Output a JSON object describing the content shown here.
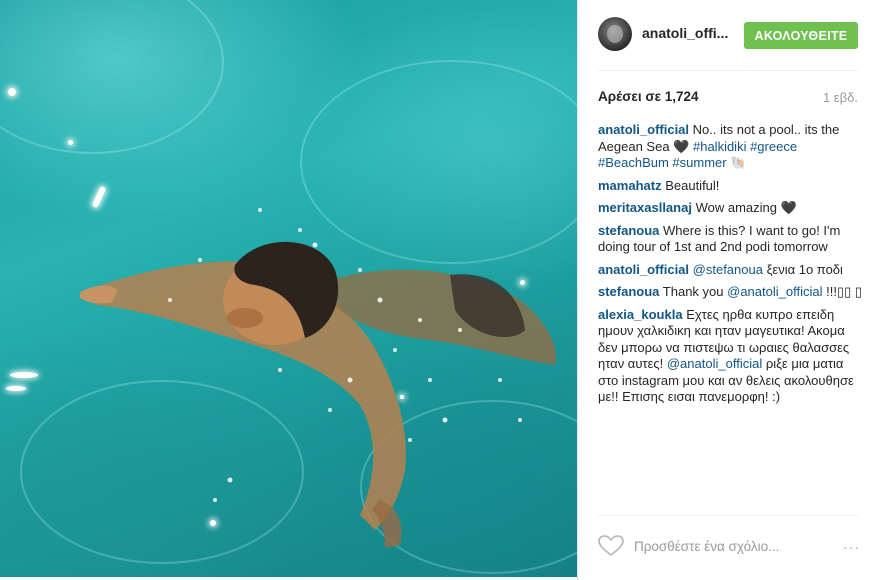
{
  "post": {
    "image_alt": "woman swimming in turquoise Aegean sea",
    "header": {
      "username": "anatoli_offi...",
      "follow_label": "ΑΚΟΛΟΥΘΕΙΤΕ"
    },
    "likes_label": "Αρέσει σε 1,724",
    "time_label": "1 εβδ.",
    "comments": [
      {
        "user": "anatoli_official",
        "text": "No.. its not a pool.. its the Aegean Sea 🖤 ",
        "tags": "#halkidiki #greece #BeachBum #summer",
        "tail": " 🐚"
      },
      {
        "user": "mamahatz",
        "text": "Beautiful!"
      },
      {
        "user": "meritaxasllanaj",
        "text": "Wow amazing 🖤"
      },
      {
        "user": "stefanoua",
        "text": "Where is this? I want to go! I'm doing tour of 1st and 2nd podi tomorrow"
      },
      {
        "user": "anatoli_official",
        "mention": "@stefanoua",
        "text": " ξενια 1ο ποδι"
      },
      {
        "user": "stefanoua",
        "pre": "Thank you ",
        "mention": "@anatoli_official",
        "text": " !!!▯▯ ▯"
      },
      {
        "user": "alexia_koukla",
        "text": "Εχτες ηρθα κυπρο επειδη ημουν χαλκιδικη και ηταν μαγευτικα! Ακομα δεν μπορω να πιστεψω τι ωραιες θαλασσες ηταν αυτες! ",
        "mention": "@anatoli_official",
        "text2": " ριξε μια ματια στο instagram μου και αν θελεις ακολουθησε με!! Επισης εισαι πανεμορφη! :)"
      }
    ],
    "add_comment_placeholder": "Προσθέστε ένα σχόλιο...",
    "more_label": "···",
    "colors": {
      "follow": "#70c050",
      "link": "#125688"
    }
  }
}
